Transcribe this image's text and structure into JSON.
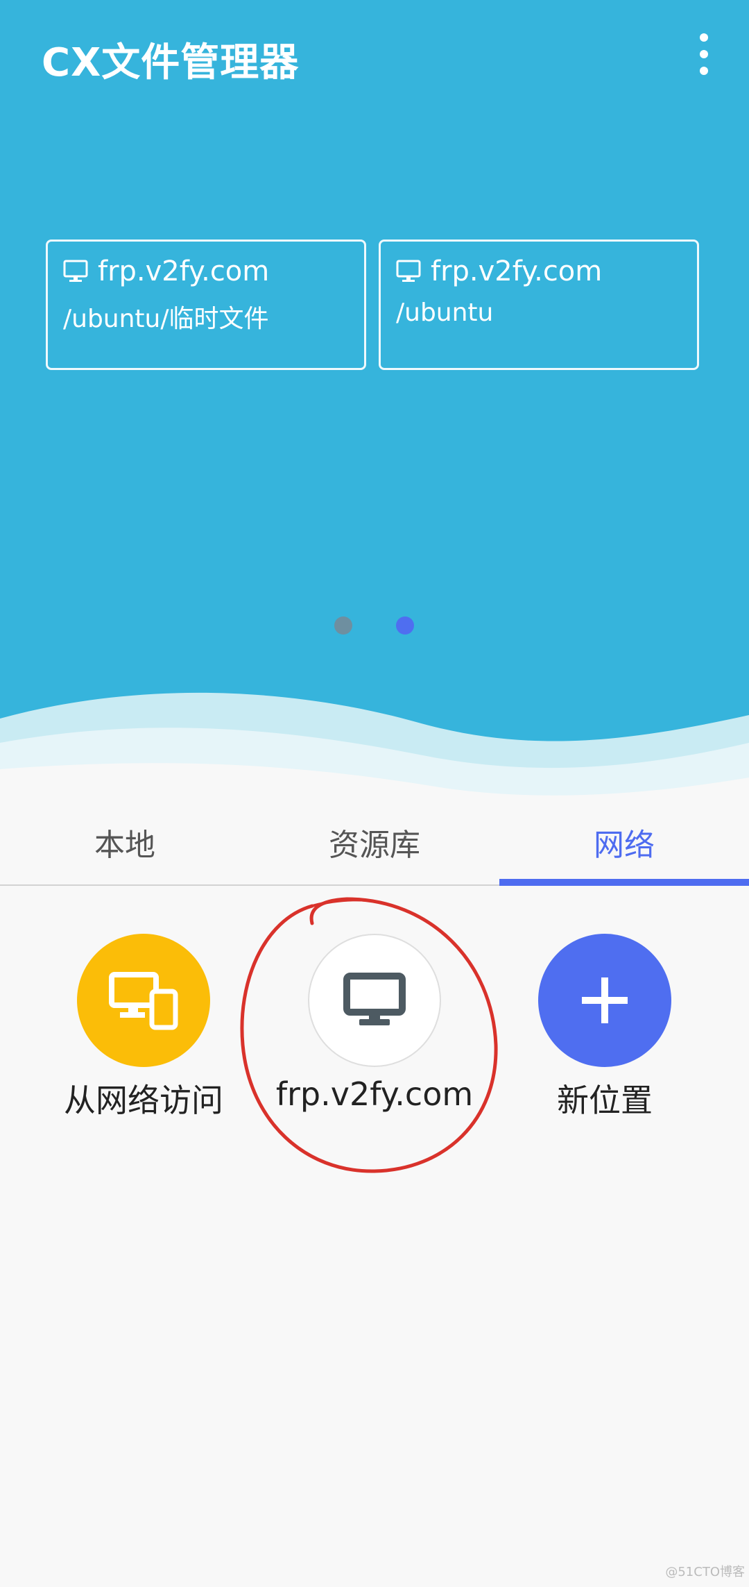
{
  "app": {
    "title": "CX文件管理器"
  },
  "recent": [
    {
      "host": "frp.v2fy.com",
      "path": "/ubuntu/临时文件"
    },
    {
      "host": "frp.v2fy.com",
      "path": "/ubuntu"
    }
  ],
  "pager": {
    "count": 2,
    "active": 2
  },
  "tabs": [
    {
      "label": "本地",
      "active": false
    },
    {
      "label": "资源库",
      "active": false
    },
    {
      "label": "网络",
      "active": true
    }
  ],
  "shortcuts": [
    {
      "label": "从网络访问",
      "icon": "devices-icon"
    },
    {
      "label": "frp.v2fy.com",
      "icon": "monitor-icon"
    },
    {
      "label": "新位置",
      "icon": "plus-icon"
    }
  ],
  "watermark": "@51CTO博客",
  "colors": {
    "hero": "#36b4dc",
    "accent": "#4e6cf0",
    "yellow": "#fbbd08",
    "annotation": "#d9322b"
  }
}
